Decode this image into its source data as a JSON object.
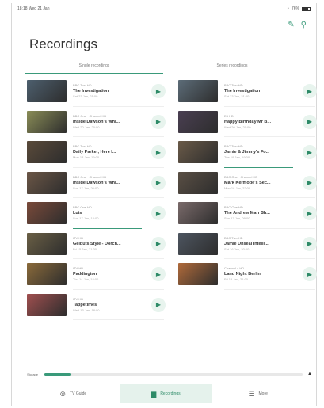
{
  "status": {
    "time": "18:18 Wed 21 Jan",
    "battery": "76%"
  },
  "actions": {
    "edit_icon": "pencil-icon",
    "filter_icon": "filter-icon"
  },
  "title": "Recordings",
  "tabs": [
    {
      "label": "Single recordings",
      "active": true
    },
    {
      "label": "Series recordings",
      "active": false
    }
  ],
  "left_items": [
    {
      "channel": "BBC Two HD",
      "title": "The Investigation",
      "date": "Sat 23 Jan, 21:00",
      "thumb": "#4d5f6e",
      "progress": false
    },
    {
      "channel": "BBC One · Channel HD",
      "title": "Inside Dawson's Whi...",
      "date": "Wed 20 Jan, 20:00",
      "thumb": "#8a8d57",
      "progress": false
    },
    {
      "channel": "BBC Two HD",
      "title": "Daily Parker, Here I...",
      "date": "Mon 18 Jan, 19:00",
      "thumb": "#5a4a3a",
      "progress": false
    },
    {
      "channel": "BBC One · Channel HD",
      "title": "Inside Dawson's Whi...",
      "date": "Sun 17 Jan, 20:00",
      "thumb": "#6b5646",
      "progress": false
    },
    {
      "channel": "BBC One HD",
      "title": "Luis",
      "date": "Sun 17 Jan, 18:00",
      "thumb": "#7a4a3a",
      "progress": true
    },
    {
      "channel": "ITV HD",
      "title": "Gelbuts Style - Dorch...",
      "date": "Fri 15 Jan, 21:00",
      "thumb": "#6a5f45",
      "progress": false
    },
    {
      "channel": "ITV HD",
      "title": "Paddington",
      "date": "Thu 14 Jan, 18:00",
      "thumb": "#8a6a3a",
      "progress": false
    },
    {
      "channel": "ITV HD",
      "title": "Tappetimes",
      "date": "Wed 13 Jan, 18:00",
      "thumb": "#a04f4f",
      "progress": false
    }
  ],
  "right_items": [
    {
      "channel": "BBC Two HD",
      "title": "The Investigation",
      "date": "Sat 23 Jan, 21:00",
      "thumb": "#5c6c78",
      "progress": false
    },
    {
      "channel": "E4 HD",
      "title": "Happy Birthday Mr B...",
      "date": "Wed 20 Jan, 20:00",
      "thumb": "#4a3f52",
      "progress": false
    },
    {
      "channel": "BBC Two HD",
      "title": "Jamie & Jimmy's Fo...",
      "date": "Tue 19 Jan, 19:00",
      "thumb": "#6a5a48",
      "progress": true
    },
    {
      "channel": "BBC One · Channel HD",
      "title": "Mark Kermode's Sec...",
      "date": "Mon 18 Jan, 22:00",
      "thumb": "#5a4f44",
      "progress": false
    },
    {
      "channel": "BBC One HD",
      "title": "The Andrew Marr Sh...",
      "date": "Sun 17 Jan, 09:00",
      "thumb": "#7a6a6a",
      "progress": false
    },
    {
      "channel": "BBC Two HD",
      "title": "Jamie Unseal Intelli...",
      "date": "Sat 16 Jan, 20:00",
      "thumb": "#4d5560",
      "progress": false
    },
    {
      "channel": "Channel 4 HD",
      "title": "Land Night Berlin",
      "date": "Fri 15 Jan, 21:00",
      "thumb": "#b06a3a",
      "progress": false
    }
  ],
  "play_icon": "▶",
  "storage": {
    "label": "Storage",
    "fill": 0.1
  },
  "nav": [
    {
      "label": "TV Guide",
      "icon": "⊜",
      "active": false
    },
    {
      "label": "Recordings",
      "icon": "▆",
      "active": true
    },
    {
      "label": "More",
      "icon": "☰",
      "active": false
    }
  ]
}
